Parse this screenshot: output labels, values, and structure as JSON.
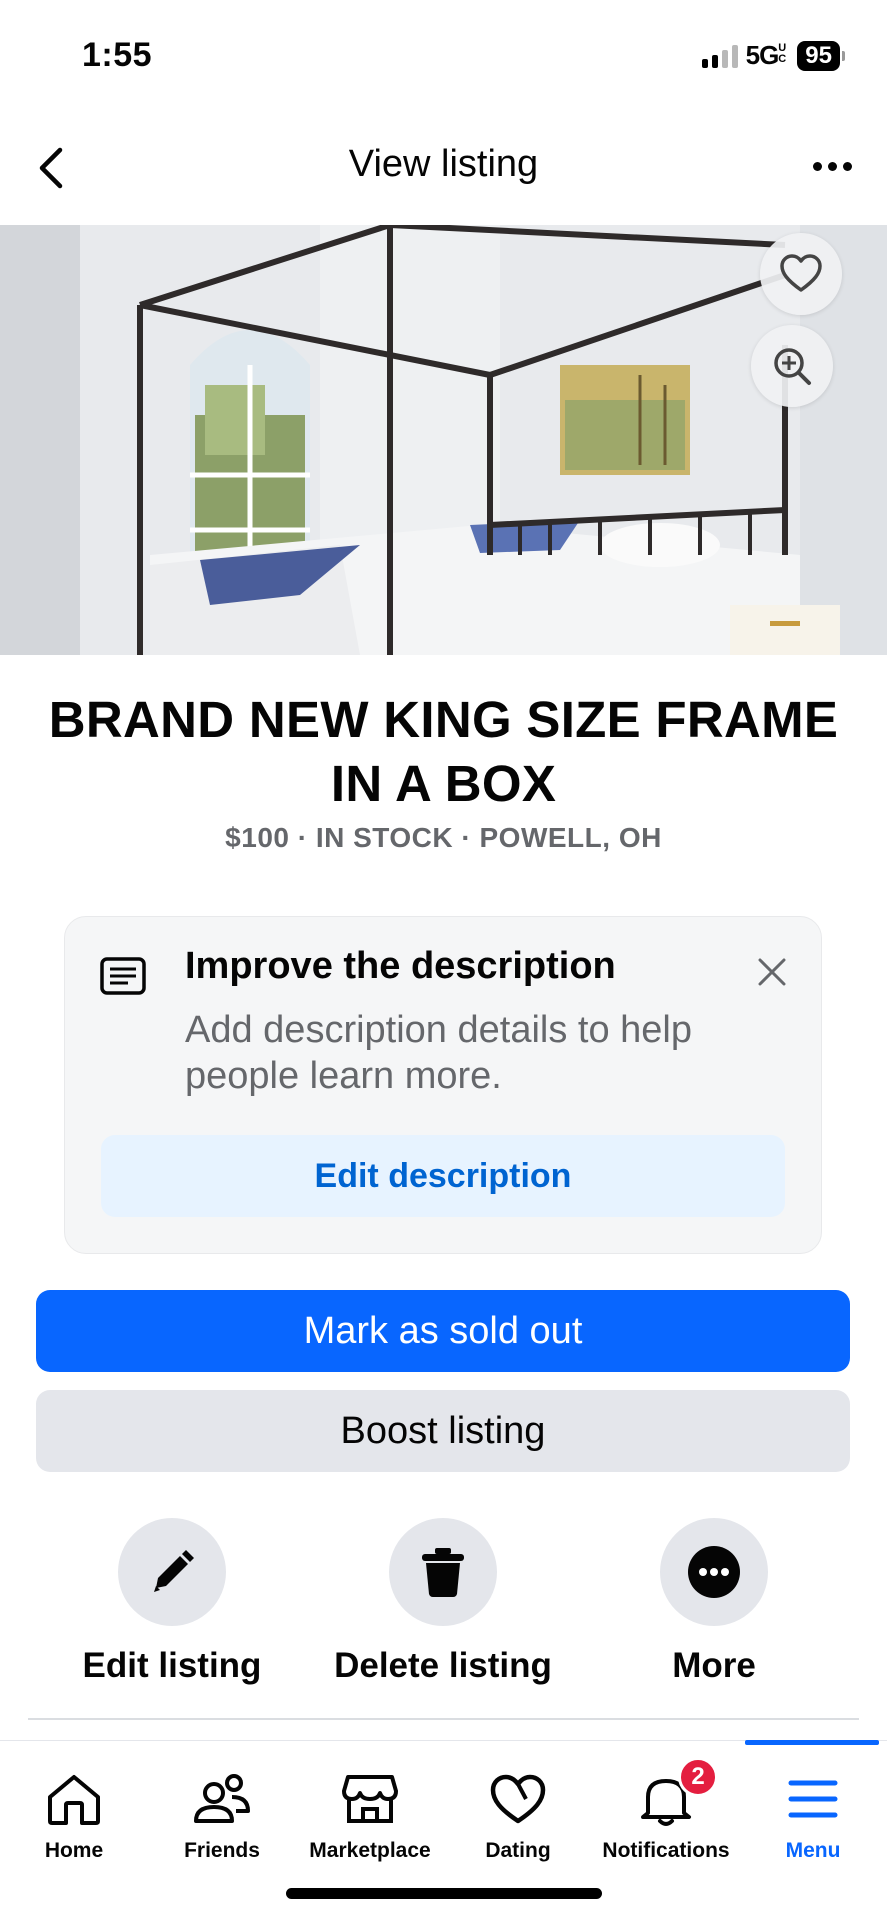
{
  "status_bar": {
    "time": "1:55",
    "network": "5G",
    "network_suffix": "UC",
    "battery": "95"
  },
  "nav": {
    "title": "View listing",
    "back_icon": "chevron-left-icon",
    "more_icon": "more-horizontal-icon"
  },
  "hero": {
    "image_alt": "Canopy bed photo",
    "like_icon": "heart-outline-icon",
    "zoom_icon": "zoom-in-icon"
  },
  "listing": {
    "title": "BRAND NEW KING SIZE FRAME IN A BOX",
    "meta": "$100 · IN STOCK · POWELL, OH"
  },
  "improve_card": {
    "title": "Improve the description",
    "description": "Add description details to help people learn more.",
    "button_label": "Edit description",
    "icon": "description-icon",
    "close_icon": "close-icon"
  },
  "buttons": {
    "mark_sold": "Mark as sold out",
    "boost": "Boost listing"
  },
  "actions": [
    {
      "label": "Edit listing",
      "icon": "pencil-icon"
    },
    {
      "label": "Delete listing",
      "icon": "trash-icon"
    },
    {
      "label": "More",
      "icon": "more-circle-icon"
    }
  ],
  "tabbar": {
    "tabs": [
      {
        "label": "Home",
        "icon": "home-icon"
      },
      {
        "label": "Friends",
        "icon": "friends-icon"
      },
      {
        "label": "Marketplace",
        "icon": "marketplace-icon"
      },
      {
        "label": "Dating",
        "icon": "dating-heart-icon"
      },
      {
        "label": "Notifications",
        "icon": "bell-icon",
        "badge": "2"
      },
      {
        "label": "Menu",
        "icon": "hamburger-menu-icon",
        "active": true
      }
    ]
  },
  "colors": {
    "primary": "#0866ff",
    "secondary_bg": "#e4e6eb",
    "muted_text": "#65676b",
    "badge": "#e41e3f",
    "link": "#0064d1"
  }
}
